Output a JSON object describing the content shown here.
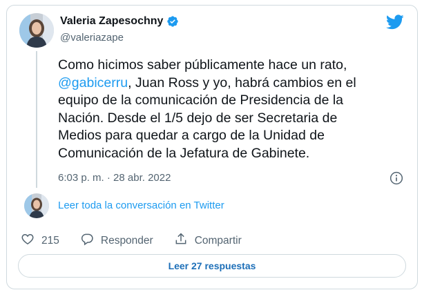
{
  "author": {
    "display_name": "Valeria Zapesochny",
    "handle": "@valeriazape",
    "verified": true,
    "avatar_icon": "profile-photo"
  },
  "tweet": {
    "lines": [
      {
        "pre": "Como hicimos saber públicamente hace un rato,",
        "mention": "",
        "post": ""
      },
      {
        "pre": "",
        "mention": "@gabicerru",
        "post": ", Juan Ross y yo, habrá cambios en el"
      },
      {
        "pre": "equipo de la comunicación de Presidencia de la",
        "mention": "",
        "post": ""
      },
      {
        "pre": "Nación. Desde el 1/5 dejo de ser Secretaria de",
        "mention": "",
        "post": ""
      },
      {
        "pre": "Medios para quedar a cargo de la Unidad de",
        "mention": "",
        "post": ""
      },
      {
        "pre": "Comunicación de la Jefatura de Gabinete.",
        "mention": "",
        "post": ""
      }
    ],
    "timestamp": "6:03 p. m. · 28 abr. 2022"
  },
  "conversation_link": "Leer toda la conversación en Twitter",
  "actions": {
    "likes_count": "215",
    "reply_label": "Responder",
    "share_label": "Compartir"
  },
  "replies_button_label": "Leer 27 respuestas",
  "colors": {
    "accent": "#1d9bf0",
    "text": "#0f1419",
    "muted": "#536471",
    "border": "#cfd9de"
  }
}
